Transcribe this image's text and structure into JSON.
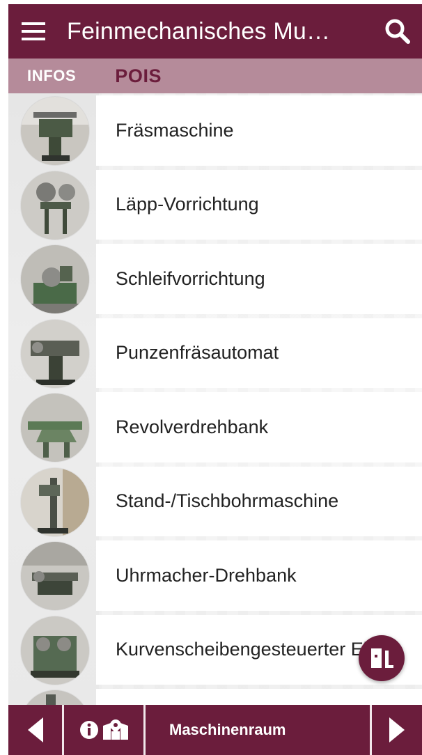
{
  "app_bar": {
    "title": "Feinmechanisches Mu…",
    "menu_icon": "hamburger-menu-icon",
    "search_icon": "search-icon"
  },
  "tabs": [
    {
      "label": "INFOS",
      "active": false
    },
    {
      "label": "POIS",
      "active": true
    }
  ],
  "pois": [
    {
      "label": "Fräsmaschine"
    },
    {
      "label": "Läpp-Vorrichtung"
    },
    {
      "label": "Schleifvorrichtung"
    },
    {
      "label": "Punzenfräsautomat"
    },
    {
      "label": "Revolverdrehbank"
    },
    {
      "label": "Stand-/Tischbohrmaschine"
    },
    {
      "label": "Uhrmacher-Drehbank"
    },
    {
      "label": "Kurvenscheibengesteuerter Ein"
    },
    {
      "label": ""
    }
  ],
  "fab": {
    "icon": "door-exit-icon"
  },
  "bottom_bar": {
    "prev_icon": "arrow-left-icon",
    "info_icon": "info-circle-icon",
    "map_icon": "map-marker-icon",
    "room": "Maschinenraum",
    "next_icon": "arrow-right-icon"
  },
  "colors": {
    "primary": "#6b1d3c",
    "tab_bar": "#b58b9a",
    "tab_active_text": "#6b1d3c",
    "tab_inactive_text": "#ffffff"
  }
}
